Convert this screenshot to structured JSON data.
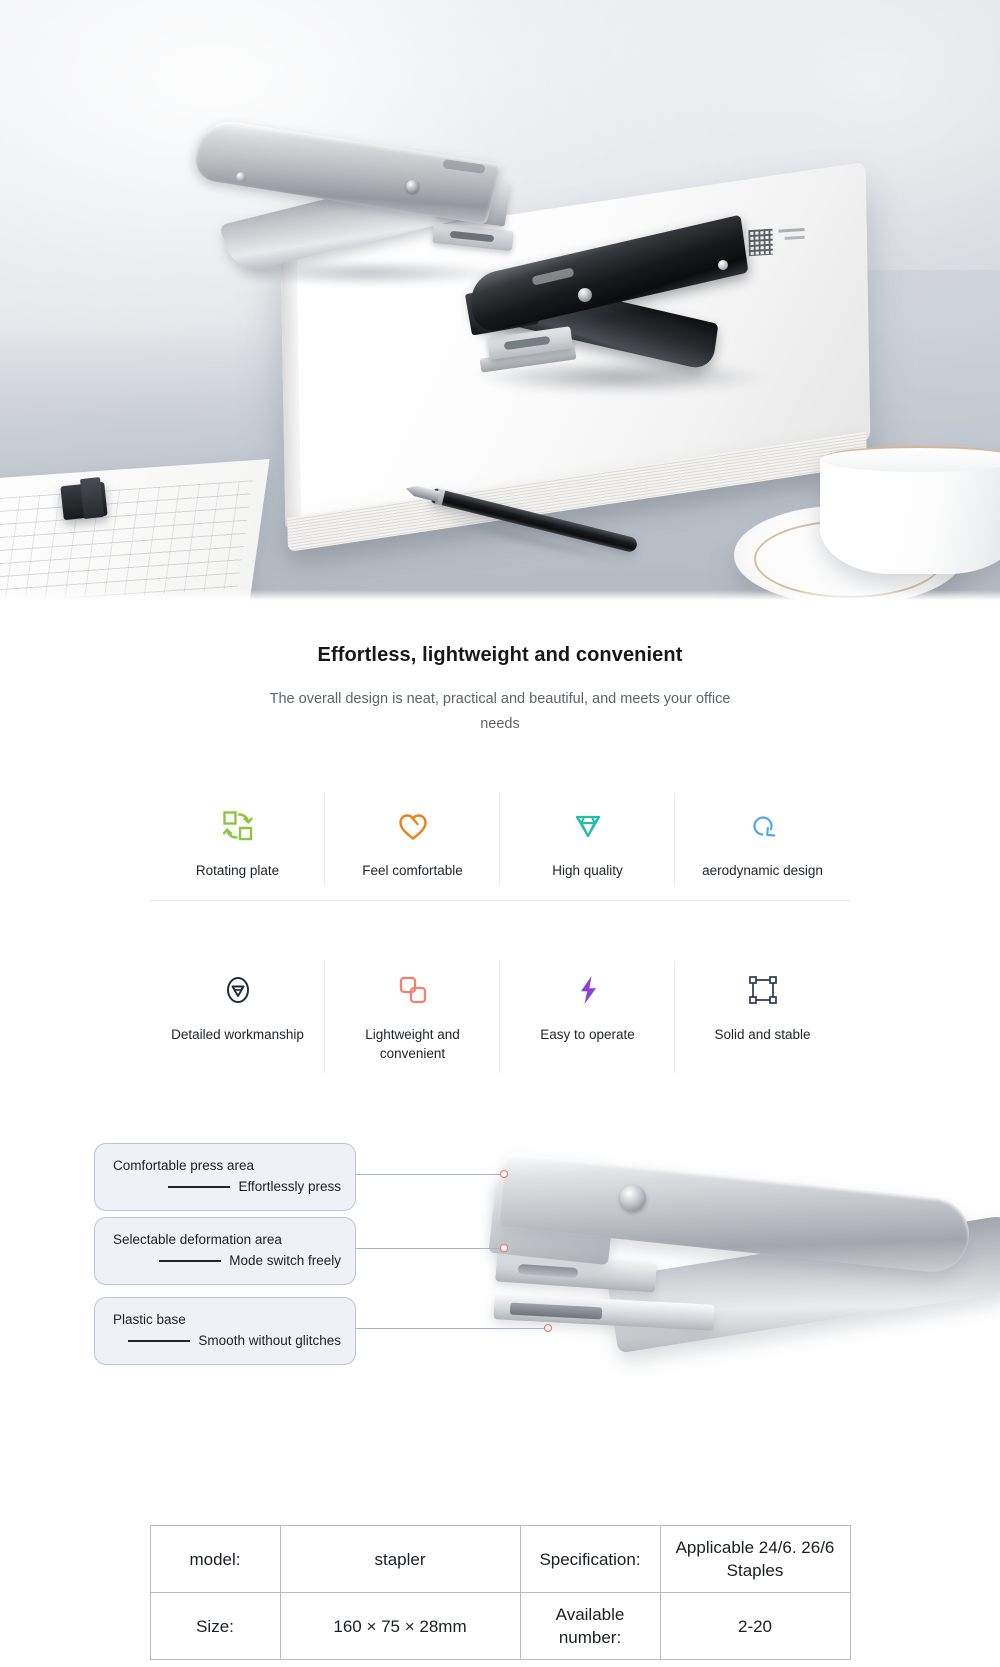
{
  "hero": {
    "alt": "Two plier staplers, silver and black, on a white notebook with pen and coffee cup"
  },
  "features": {
    "title": "Effortless, lightweight and convenient",
    "subtitle": "The overall design is neat, practical and beautiful, and meets your office needs",
    "items": [
      {
        "label": "Rotating plate",
        "icon": "rotate-squares-icon",
        "color": "#8cc63f"
      },
      {
        "label": "Feel comfortable",
        "icon": "heart-icon",
        "color": "#e8821a"
      },
      {
        "label": "High quality",
        "icon": "diamond-icon",
        "color": "#1fbfa8"
      },
      {
        "label": "aerodynamic design",
        "icon": "refresh-circle-icon",
        "color": "#55a8e8"
      },
      {
        "label": "Detailed workmanship",
        "icon": "gem-badge-icon",
        "color": "#1f2d3d"
      },
      {
        "label": "Lightweight and convenient",
        "icon": "copy-squares-icon",
        "color": "#f08070"
      },
      {
        "label": "Easy to operate",
        "icon": "lightning-bolt-icon",
        "color": "#8b3fe0"
      },
      {
        "label": "Solid and stable",
        "icon": "bounding-box-icon",
        "color": "#2b3a52"
      }
    ]
  },
  "callouts": [
    {
      "title": "Comfortable press area",
      "detail": "Effortlessly press"
    },
    {
      "title": "Selectable deformation area",
      "detail": "Mode switch freely"
    },
    {
      "title": "Plastic base",
      "detail": "Smooth without glitches"
    }
  ],
  "spec_table": {
    "rows": [
      [
        {
          "text": "model:"
        },
        {
          "text": "stapler"
        },
        {
          "text": "Specification:"
        },
        {
          "text": "Applicable 24/6. 26/6 Staples"
        }
      ],
      [
        {
          "text": "Size:"
        },
        {
          "text": "160 × 75 × 28mm"
        },
        {
          "text": "Available number:"
        },
        {
          "text": "2-20"
        }
      ]
    ]
  }
}
